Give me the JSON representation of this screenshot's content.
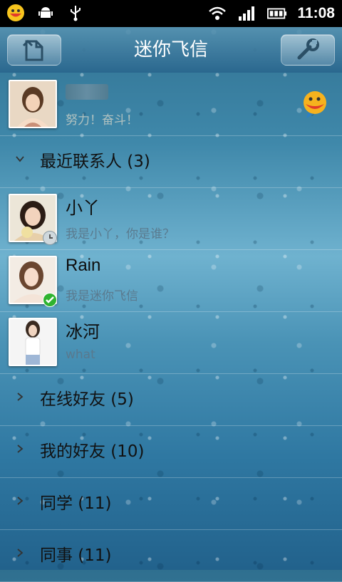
{
  "status_bar": {
    "time": "11:08",
    "left_icons": [
      "fetion-notification-icon",
      "android-debug-icon",
      "usb-icon"
    ],
    "right_icons": [
      "wifi-icon",
      "signal-icon",
      "battery-icon"
    ]
  },
  "header": {
    "title": "迷你飞信"
  },
  "profile": {
    "signature": "努力！奋斗！",
    "status_icon": "online-smiley-icon"
  },
  "groups": {
    "recent": "最近联系人 (3)",
    "online": "在线好友 (5)",
    "friends": "我的好友 (10)",
    "classmates": "同学 (11)",
    "colleagues": "同事 (11)"
  },
  "contacts": [
    {
      "name": "小丫",
      "signature": "我是小丫，你是谁？",
      "status": "away"
    },
    {
      "name": "Rain",
      "signature": "我是迷你飞信",
      "status": "online"
    },
    {
      "name": "冰河",
      "signature": "what",
      "status": "offline"
    }
  ],
  "colors": {
    "titlebar": "#3f7fa6",
    "online_badge": "#2fb32f"
  }
}
